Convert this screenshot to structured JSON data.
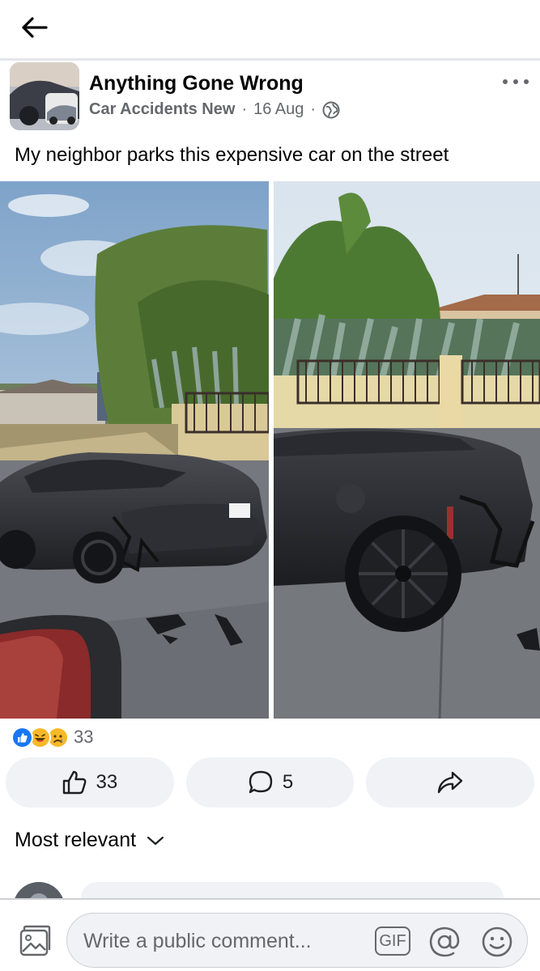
{
  "post": {
    "title": "Anything Gone Wrong",
    "group": "Car Accidents New",
    "separator": "·",
    "date": "16 Aug",
    "privacy_icon": "globe-icon",
    "text": "My neighbor parks this expensive car on the street"
  },
  "reactions": {
    "icons": [
      "like-icon",
      "haha-icon",
      "sad-icon"
    ],
    "count": "33"
  },
  "actions": {
    "like_count": "33",
    "comment_count": "5",
    "share_icon": "share-icon"
  },
  "comments": {
    "sort_label": "Most relevant"
  },
  "composer": {
    "placeholder": "Write a public comment...",
    "gif_label": "GIF"
  },
  "colors": {
    "like_blue": "#1877f2",
    "secondary_text": "#65676b",
    "button_bg": "#f0f2f5"
  }
}
